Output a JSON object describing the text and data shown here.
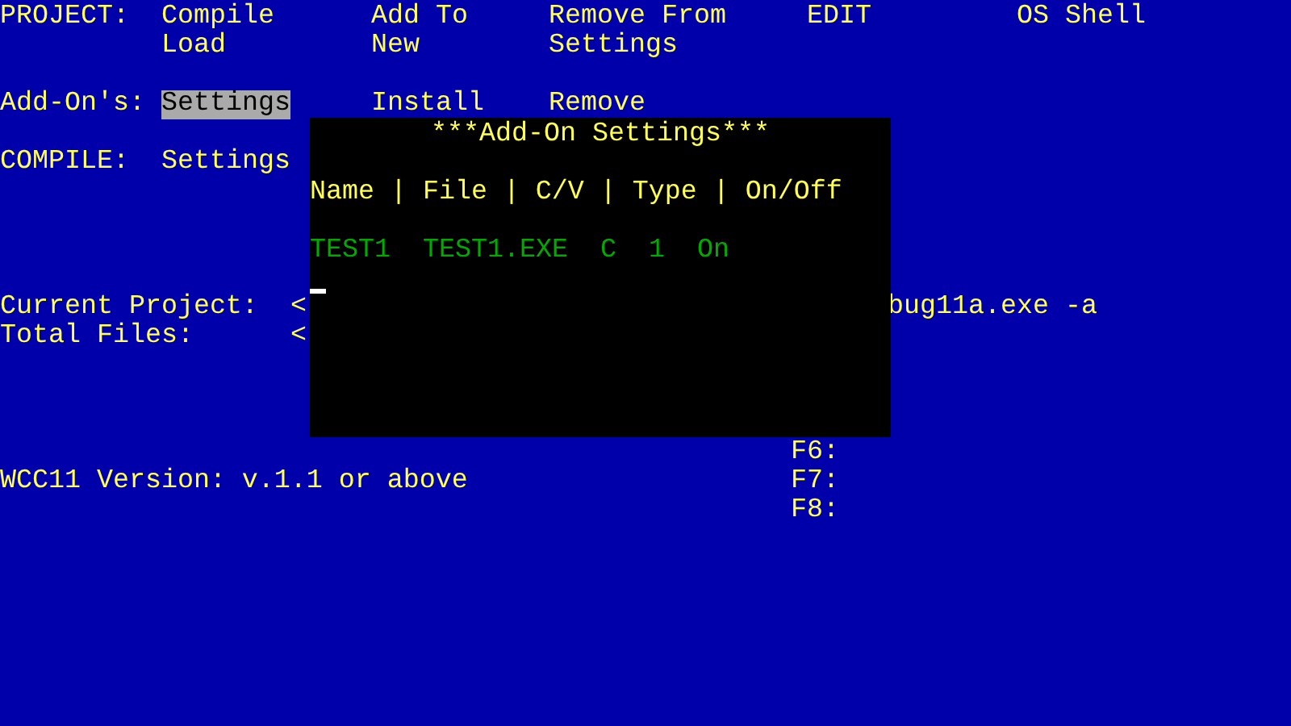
{
  "menus": [
    {
      "label": "PROJECT:",
      "rows": [
        [
          {
            "text": "Compile",
            "selected": false
          },
          {
            "text": "Add To",
            "selected": false
          },
          {
            "text": "Remove From",
            "selected": false
          },
          {
            "text": "EDIT",
            "selected": false
          },
          {
            "text": "OS Shell",
            "selected": false
          }
        ],
        [
          {
            "text": "Load",
            "selected": false
          },
          {
            "text": "New",
            "selected": false
          },
          {
            "text": "Settings",
            "selected": false
          }
        ]
      ]
    },
    {
      "label": "Add-On's:",
      "rows": [
        [
          {
            "text": "Settings",
            "selected": true
          },
          {
            "text": "Install",
            "selected": false
          },
          {
            "text": "Remove",
            "selected": false
          }
        ]
      ]
    },
    {
      "label": "COMPILE:",
      "rows": [
        [
          {
            "text": "Settings",
            "selected": false
          }
        ]
      ]
    }
  ],
  "status": {
    "current_project_label": "Current Project:",
    "current_project_marker": "<",
    "current_project_value": "bug11a.exe -a",
    "total_files_label": "Total Files:",
    "total_files_marker": "<"
  },
  "version": "WCC11 Version: v.1.1 or above",
  "function_keys": [
    "F6:",
    "F7:",
    "F8:"
  ],
  "dialog": {
    "title": "***Add-On Settings***",
    "header": "Name | File | C/V | Type | On/Off",
    "rows": [
      {
        "name": "TEST1",
        "file": "TEST1.EXE",
        "cv": "C",
        "type": "1",
        "state": "On"
      }
    ]
  }
}
